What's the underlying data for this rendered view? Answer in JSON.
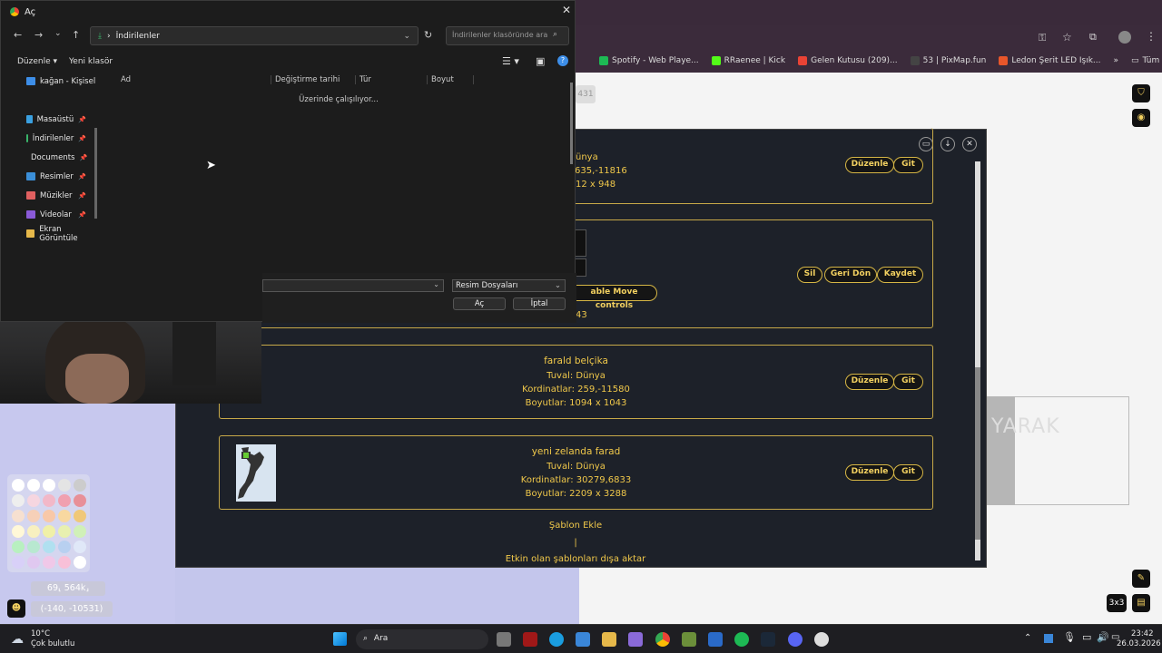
{
  "browser": {
    "bookmarks": [
      {
        "label": "Spotify - Web Playe...",
        "color": "#1DB954"
      },
      {
        "label": "RRaenee | Kick",
        "color": "#53FC18"
      },
      {
        "label": "Gelen Kutusu (209)...",
        "color": "#EA4335"
      },
      {
        "label": "53 | PixMap.fun",
        "color": "#444444"
      },
      {
        "label": "Ledon Şerit LED Işık...",
        "color": "#E8562A"
      }
    ],
    "all_bookmarks": "Tüm Yer İşaretleri",
    "more_bookmarks": "»"
  },
  "dialog": {
    "title": "Aç",
    "path": "İndirilenler",
    "search_placeholder": "İndirilenler klasöründe ara",
    "organize": "Düzenle",
    "new_folder": "Yeni klasör",
    "columns": [
      "Ad",
      "Değiştirme tarihi",
      "Tür",
      "Boyut"
    ],
    "working": "Üzerinde çalışılıyor...",
    "nav": [
      {
        "label": "kağan - Kişisel",
        "icon": "cloud-icon",
        "color": "#3d8ee8",
        "pinned": false
      },
      {
        "label": "Masaüstü",
        "icon": "desktop-icon",
        "color": "#3aa0e0",
        "pinned": true
      },
      {
        "label": "İndirilenler",
        "icon": "download-icon",
        "color": "#39b46a",
        "pinned": true
      },
      {
        "label": "Documents",
        "icon": "document-icon",
        "color": "#9aa8b8",
        "pinned": true
      },
      {
        "label": "Resimler",
        "icon": "pictures-icon",
        "color": "#3b8fd8",
        "pinned": true
      },
      {
        "label": "Müzikler",
        "icon": "music-icon",
        "color": "#e06060",
        "pinned": true
      },
      {
        "label": "Videolar",
        "icon": "video-icon",
        "color": "#8a5ad8",
        "pinned": true
      },
      {
        "label": "Ekran Görüntüle",
        "icon": "folder-icon",
        "color": "#e6b84a",
        "pinned": false
      }
    ],
    "filter": "Resim Dosyaları",
    "open": "Aç",
    "cancel": "İptal"
  },
  "panel": {
    "partial_card": {
      "line1": "ünya",
      "line2": "635,-11816",
      "line3": "12 x 948"
    },
    "edit_card": {
      "toggle": "able Move controls",
      "fragment": "43"
    },
    "cards": [
      {
        "title": "farald belçika",
        "canvas": "Tuval: Dünya",
        "coords": "Kordinatlar: 259,-11580",
        "size": "Boyutlar: 1094 x 1043"
      },
      {
        "title": "yeni zelanda farad",
        "canvas": "Tuval: Dünya",
        "coords": "Kordinatlar: 30279,6833",
        "size": "Boyutlar: 2209 x 3288"
      }
    ],
    "edit": "Düzenle",
    "go": "Git",
    "delete": "Sil",
    "revert": "Geri Dön",
    "save": "Kaydet",
    "add_template": "Şablon Ekle",
    "divider": "|",
    "export": "Etkin olan şablonları dışa aktar"
  },
  "map": {
    "pixel_counter": "69⸤ 564k⸥",
    "coordinates": "(-140, -10531)",
    "grid_size": "3x3",
    "text_fragment": "YARAK",
    "side_badge": "431"
  },
  "palette": [
    "#ffffff",
    "#ffffff",
    "#ffffff",
    "#e4e4e4",
    "#cccccc",
    "#eeeeee",
    "#f6d6e0",
    "#f2b8c8",
    "#f0a0b0",
    "#e89098",
    "#f6e0d0",
    "#f6d0b8",
    "#f8c8a8",
    "#f8d8a0",
    "#f0c878",
    "#fff8d8",
    "#f8f0c0",
    "#f0f0a8",
    "#e8f0b0",
    "#d0f0b8",
    "#b8f0c0",
    "#b8e8d0",
    "#b0e0f0",
    "#b8d0f0",
    "#e0e8f8",
    "#d8d0f8",
    "#e0c8f0",
    "#f0c8e8",
    "#f8c0d8",
    "#ffffff"
  ],
  "taskbar": {
    "temperature": "10°C",
    "weather": "Çok bulutlu",
    "search": "Ara",
    "time": "23:42",
    "date": "26.03.2026"
  }
}
